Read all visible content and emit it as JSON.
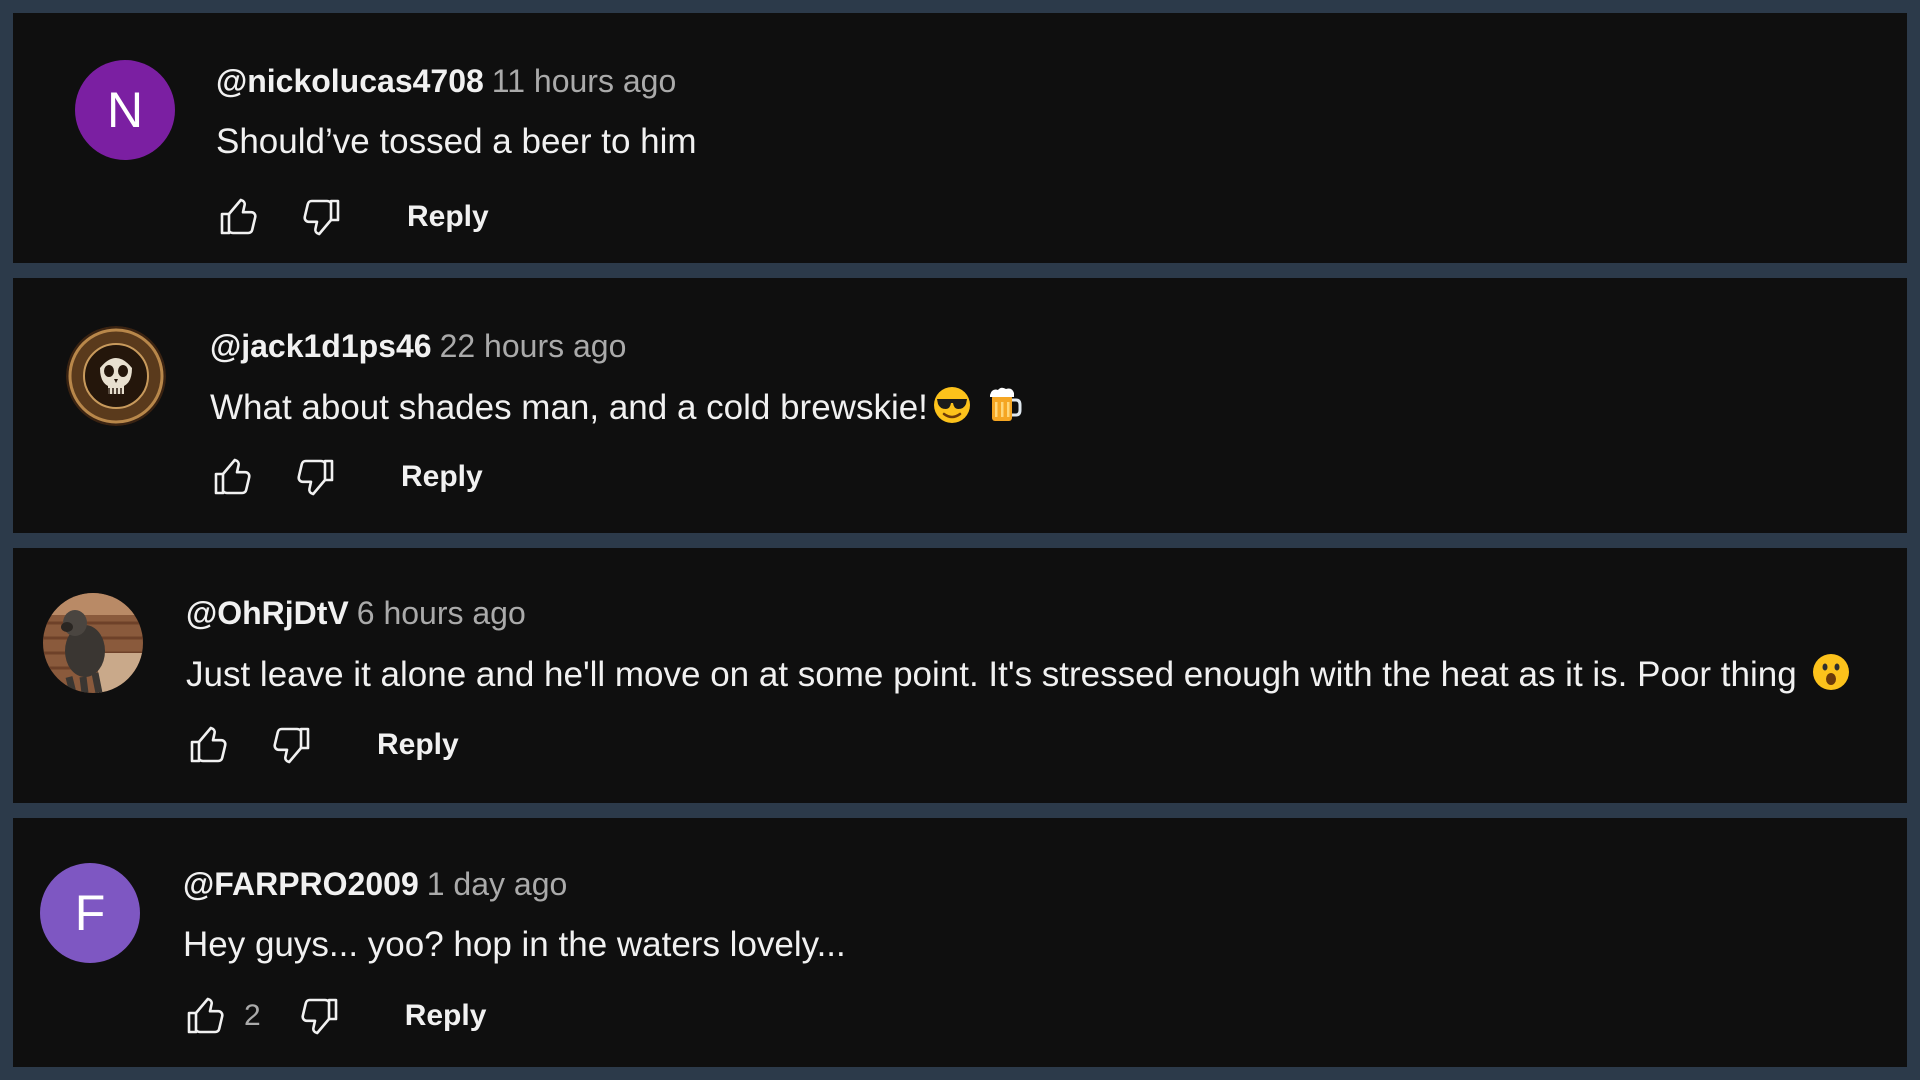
{
  "comments": [
    {
      "handle": "@nickolucas4708",
      "time": "11 hours ago",
      "text": "Should’ve tossed a beer to him",
      "avatar_letter": "N",
      "avatar_color": "#7b1fa2",
      "likes": "",
      "reply_label": "Reply"
    },
    {
      "handle": "@jack1d1ps46",
      "time": "22 hours ago",
      "text": "What about shades man, and a cold brewskie!",
      "emojis": [
        "smiling-face-with-sunglasses",
        "beer-mug"
      ],
      "avatar_image": "punisher-skull-badge",
      "likes": "",
      "reply_label": "Reply"
    },
    {
      "handle": "@OhRjDtV",
      "time": "6 hours ago",
      "text": "Just leave it alone and he'll move on at some point. It's stressed enough with the heat as it is. Poor thing",
      "emojis": [
        "hushed-face"
      ],
      "avatar_image": "dog-photo",
      "likes": "",
      "reply_label": "Reply"
    },
    {
      "handle": "@FARPRO2009",
      "time": "1 day ago",
      "text": "Hey guys... yoo? hop in the waters lovely...",
      "avatar_letter": "F",
      "avatar_color": "#7e57c2",
      "likes": "2",
      "reply_label": "Reply"
    }
  ],
  "icons": {
    "like": "thumbs-up-icon",
    "dislike": "thumbs-down-icon"
  },
  "colors": {
    "page_background": "#2c3a4a",
    "card_background": "#0f0f0f",
    "primary_text": "#f1f1f1",
    "secondary_text": "#aaaaaa"
  }
}
